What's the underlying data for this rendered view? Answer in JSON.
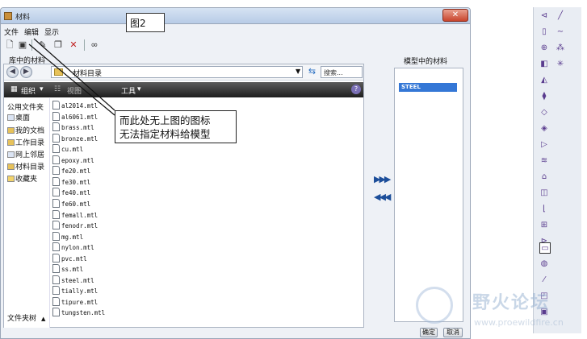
{
  "window": {
    "title": "材料"
  },
  "menu": [
    "文件",
    "编辑",
    "显示"
  ],
  "toolbar_icons": [
    "new-icon",
    "open-icon",
    "edit-icon",
    "copy-icon",
    "delete-icon",
    "view-icon"
  ],
  "labels": {
    "library": "库中的材料",
    "model": "模型中的材料"
  },
  "address": {
    "path": "材料目录",
    "search_placeholder": "搜索..."
  },
  "cmdbar": {
    "organize": "组织",
    "view": "视图",
    "tools": "工具"
  },
  "nav": {
    "items": [
      "公用文件夹",
      "桌面",
      "我的文档",
      "工作目录",
      "网上邻居",
      "材料目录",
      "收藏夹"
    ],
    "footer": "文件夹树"
  },
  "files": [
    "al2014.mtl",
    "al6061.mtl",
    "brass.mtl",
    "bronze.mtl",
    "cu.mtl",
    "epoxy.mtl",
    "fe20.mtl",
    "fe30.mtl",
    "fe40.mtl",
    "fe60.mtl",
    "femall.mtl",
    "fenodr.mtl",
    "mg.mtl",
    "nylon.mtl",
    "pvc.mtl",
    "ss.mtl",
    "steel.mtl",
    "tially.mtl",
    "tipure.mtl",
    "tungsten.mtl"
  ],
  "model_materials": [
    "STEEL"
  ],
  "buttons": {
    "ok": "确定",
    "cancel": "取消"
  },
  "annotations": {
    "figure": "图2",
    "callout_line1": "而此处无上图的图标",
    "callout_line2": "无法指定材料给模型"
  },
  "watermark": {
    "text": "野火论坛",
    "url": "www.proewildfire.cn"
  },
  "colors": {
    "selection": "#3477d6",
    "cmdbar": "#2a2a2a"
  }
}
